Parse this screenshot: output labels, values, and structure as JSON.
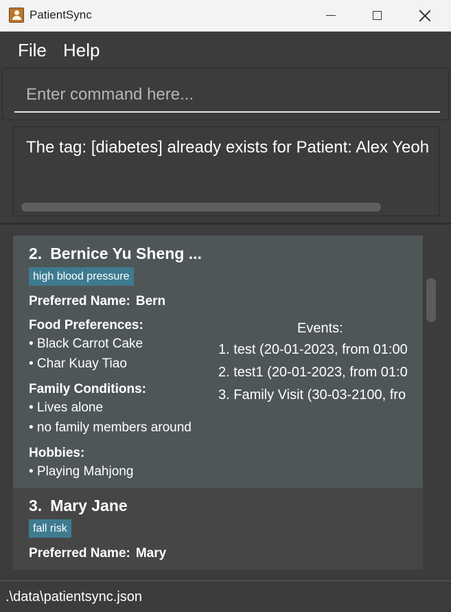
{
  "window": {
    "title": "PatientSync",
    "app_icon": "patient-app-icon",
    "controls": [
      "minimize-icon",
      "maximize-icon",
      "close-icon"
    ]
  },
  "menu": {
    "file": "File",
    "help": "Help"
  },
  "command": {
    "placeholder": "Enter command here...",
    "value": ""
  },
  "result": {
    "message": "The tag: [diabetes] already exists for Patient: Alex Yeoh"
  },
  "patients": [
    {
      "index": "2.",
      "name": "Bernice Yu Sheng ...",
      "tags": [
        "high blood pressure"
      ],
      "preferred_name_label": "Preferred Name:",
      "preferred_name": "Bern",
      "food_label": "Food Preferences:",
      "food": [
        "• Black Carrot Cake",
        "• Char Kuay Tiao"
      ],
      "family_label": "Family Conditions:",
      "family": [
        "• Lives alone",
        "• no family members around"
      ],
      "hobbies_label": "Hobbies:",
      "hobbies": [
        "• Playing Mahjong"
      ],
      "events_label": "Events:",
      "events": [
        "1. test (20-01-2023, from 01:00",
        "2. test1 (20-01-2023, from 01:0",
        "3. Family Visit (30-03-2100, fro"
      ]
    },
    {
      "index": "3.",
      "name": "Mary Jane",
      "tags": [
        "fall risk"
      ],
      "preferred_name_label": "Preferred Name:",
      "preferred_name": "Mary"
    }
  ],
  "status": {
    "file_path": ".\\data\\patientsync.json"
  },
  "colors": {
    "background": "#3c3c3c",
    "selected_card": "#4f5658",
    "tag": "#3e7b91"
  }
}
